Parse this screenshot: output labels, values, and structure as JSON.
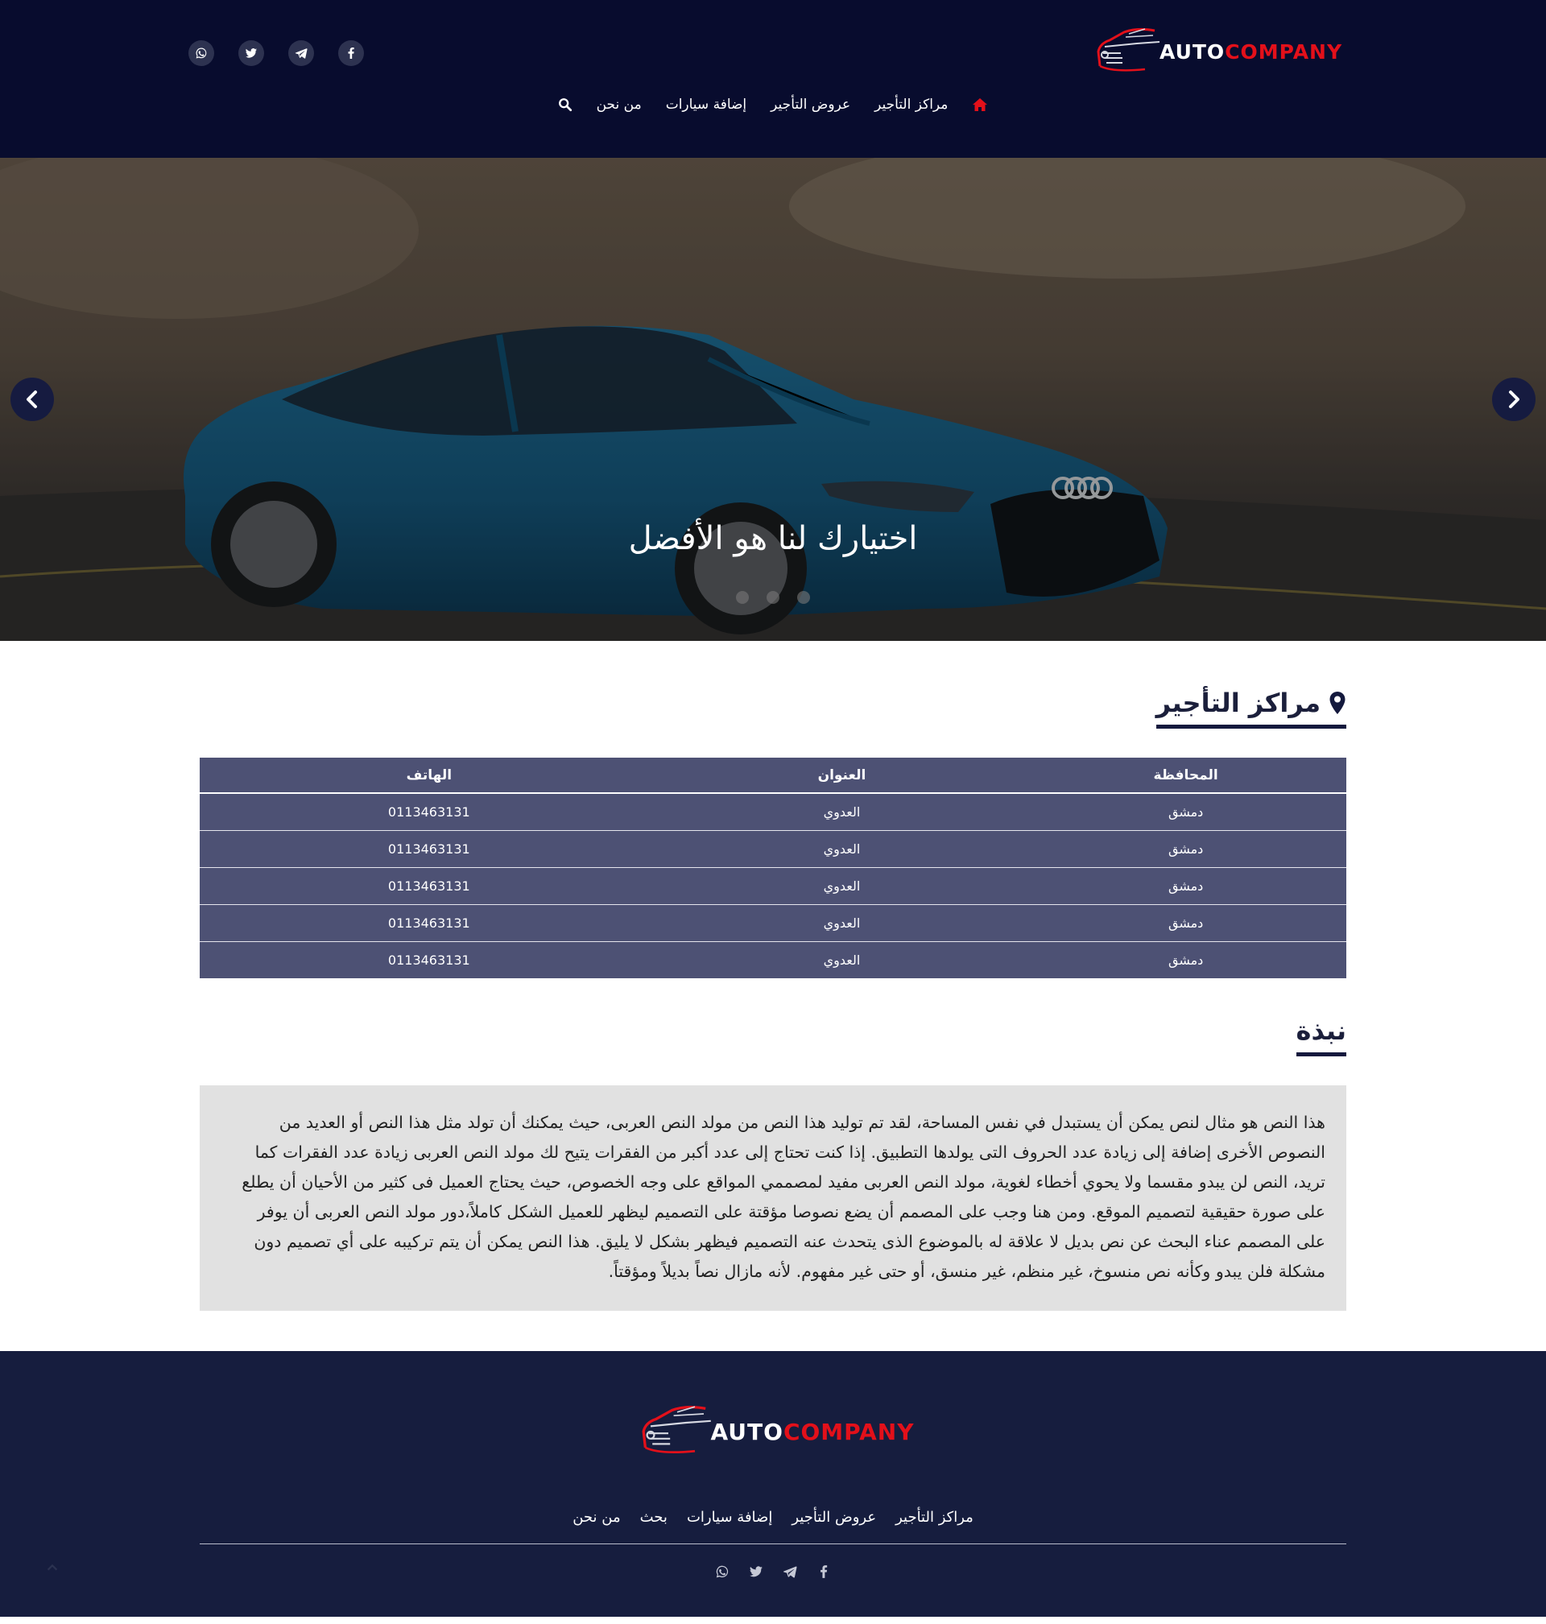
{
  "brand": {
    "logo_white": "AUTO",
    "logo_red": "COMPANY"
  },
  "header": {
    "nav": [
      {
        "label": "مراكز التأجير"
      },
      {
        "label": "عروض التأجير"
      },
      {
        "label": "إضافة سيارات"
      },
      {
        "label": "من نحن"
      }
    ],
    "socials": [
      "whatsapp-icon",
      "twitter-icon",
      "telegram-icon",
      "facebook-icon"
    ]
  },
  "hero": {
    "caption": "اختيارك لنا هو الأفضل",
    "slide_count": 3
  },
  "centers": {
    "title": "مراكز التأجير",
    "columns": [
      "المحافظة",
      "العنوان",
      "الهاتف"
    ],
    "rows": [
      [
        "دمشق",
        "العدوي",
        "0113463131"
      ],
      [
        "دمشق",
        "العدوي",
        "0113463131"
      ],
      [
        "دمشق",
        "العدوي",
        "0113463131"
      ],
      [
        "دمشق",
        "العدوي",
        "0113463131"
      ],
      [
        "دمشق",
        "العدوي",
        "0113463131"
      ]
    ]
  },
  "about": {
    "title": "نبذة",
    "text": "هذا النص هو مثال لنص يمكن أن يستبدل في نفس المساحة، لقد تم توليد هذا النص من مولد النص العربى، حيث يمكنك أن تولد مثل هذا النص أو العديد من النصوص الأخرى إضافة إلى زيادة عدد الحروف التى يولدها التطبيق. إذا كنت تحتاج إلى عدد أكبر من الفقرات يتيح لك مولد النص العربى زيادة عدد الفقرات كما تريد، النص لن يبدو مقسما ولا يحوي أخطاء لغوية، مولد النص العربى مفيد لمصممي المواقع على وجه الخصوص، حيث يحتاج العميل فى كثير من الأحيان أن يطلع على صورة حقيقية لتصميم الموقع. ومن هنا وجب على المصمم أن يضع نصوصا مؤقتة على التصميم ليظهر للعميل الشكل كاملاً،دور مولد النص العربى أن يوفر على المصمم عناء البحث عن نص بديل لا علاقة له بالموضوع الذى يتحدث عنه التصميم فيظهر بشكل لا يليق. هذا النص يمكن أن يتم تركيبه على أي تصميم دون مشكلة فلن يبدو وكأنه نص منسوخ، غير منظم، غير منسق، أو حتى غير مفهوم. لأنه مازال نصاً بديلاً ومؤقتاً."
  },
  "footer": {
    "nav": [
      {
        "label": "مراكز التأجير"
      },
      {
        "label": "عروض التأجير"
      },
      {
        "label": "إضافة سيارات"
      },
      {
        "label": "بحث"
      },
      {
        "label": "من نحن"
      }
    ],
    "socials": [
      "whatsapp-icon",
      "twitter-icon",
      "telegram-icon",
      "facebook-icon"
    ]
  },
  "colors": {
    "header_bg": "#080c2e",
    "accent_red": "#e3101a",
    "table_bg": "#4d5174",
    "footer_bg": "#161d3e"
  }
}
